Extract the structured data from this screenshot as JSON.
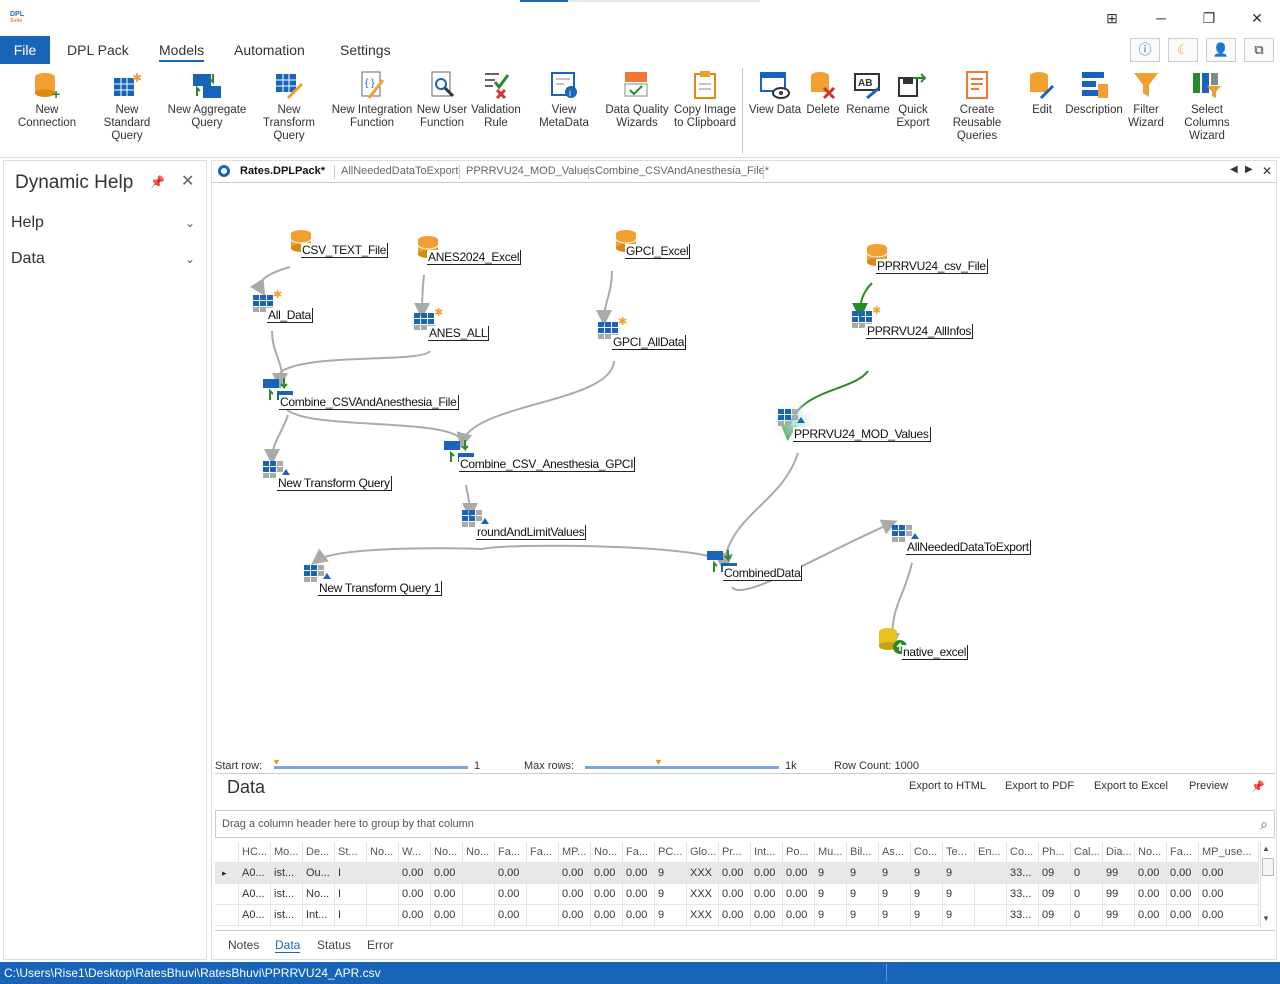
{
  "app": {
    "logo_top": "DPL",
    "logo_bottom": "Suite"
  },
  "menu": {
    "file": "File",
    "items": [
      "DPL Pack",
      "Models",
      "Automation",
      "Settings"
    ]
  },
  "top_icons": [
    "info-icon",
    "moon-icon",
    "user-icon",
    "layout-icon"
  ],
  "ribbon": {
    "buttons": [
      {
        "l1": "New Connection",
        "l2": ""
      },
      {
        "l1": "New Standard",
        "l2": "Query"
      },
      {
        "l1": "New Aggregate",
        "l2": "Query"
      },
      {
        "l1": "New Transform",
        "l2": "Query"
      },
      {
        "l1": "New Integration",
        "l2": "Function"
      },
      {
        "l1": "New User",
        "l2": "Function"
      },
      {
        "l1": "Validation",
        "l2": "Rule"
      },
      {
        "l1": "View MetaData",
        "l2": ""
      },
      {
        "l1": "Data Quality",
        "l2": "Wizards"
      },
      {
        "l1": "Copy Image",
        "l2": "to Clipboard"
      },
      {
        "l1": "View Data",
        "l2": ""
      },
      {
        "l1": "Delete",
        "l2": ""
      },
      {
        "l1": "Rename",
        "l2": ""
      },
      {
        "l1": "Quick",
        "l2": "Export"
      },
      {
        "l1": "Create Reusable",
        "l2": "Queries"
      },
      {
        "l1": "Edit",
        "l2": ""
      },
      {
        "l1": "Description",
        "l2": ""
      },
      {
        "l1": "Filter",
        "l2": "Wizard"
      },
      {
        "l1": "Select Columns",
        "l2": "Wizard"
      }
    ]
  },
  "left_panel": {
    "title": "Dynamic Help",
    "sections": [
      "Help",
      "Data"
    ]
  },
  "doc_tabs": [
    "Rates.DPLPack*",
    "AllNeededDataToExport",
    "PPRRVU24_MOD_Values",
    "Combine_CSVAndAnesthesia_File*"
  ],
  "nodes": {
    "csv_text": "CSV_TEXT_File",
    "anes_excel": "ANES2024_Excel",
    "gpci_excel": "GPCI_Excel",
    "pprrvu_csv": "PPRRVU24_csv_File",
    "all_data": "All_Data",
    "anes_all": "ANES_ALL",
    "gpci_alldata": "GPCI_AllData",
    "pprrvu_allinfos": "PPRRVU24_AllInfos",
    "combine_csv": "Combine_CSVAndAnesthesia_File",
    "pprrvu_mod": "PPRRVU24_MOD_Values",
    "new_transform": "New Transform Query",
    "combine_gpci": "Combine_CSV_Anesthesia_GPCI",
    "round_limit": "roundAndLimitValues",
    "all_needed": "AllNeededDataToExport",
    "new_transform1": "New Transform Query 1",
    "combined": "CombinedData",
    "native_excel": "native_excel"
  },
  "sliders": {
    "start_label": "Start row:",
    "start_value": "1",
    "max_label": "Max rows:",
    "max_value": "1k",
    "row_count": "Row Count: 1000"
  },
  "data_panel": {
    "title": "Data",
    "actions": [
      "Export to HTML",
      "Export to PDF",
      "Export to Excel",
      "Preview"
    ],
    "group_hint": "Drag a column header here to group by that column",
    "columns": [
      "HC...",
      "Mo...",
      "De...",
      "St...",
      "No...",
      "W...",
      "No...",
      "No...",
      "Fa...",
      "Fa...",
      "MP...",
      "No...",
      "Fa...",
      "PC...",
      "Glo...",
      "Pr...",
      "Int...",
      "Po...",
      "Mu...",
      "Bil...",
      "As...",
      "Co...",
      "Te...",
      "En...",
      "Co...",
      "Ph...",
      "Cal...",
      "Dia...",
      "No...",
      "Fa...",
      "MP_use..."
    ],
    "rows": [
      [
        "A0...",
        "ist...",
        "Ou...",
        "I",
        "",
        "0.00",
        "0.00",
        "",
        "0.00",
        "",
        "0.00",
        "0.00",
        "0.00",
        "9",
        "XXX",
        "0.00",
        "0.00",
        "0.00",
        "9",
        "9",
        "9",
        "9",
        "9",
        "",
        "33...",
        "09",
        "0",
        "99",
        "0.00",
        "0.00",
        "0.00"
      ],
      [
        "A0...",
        "ist...",
        "No...",
        "I",
        "",
        "0.00",
        "0.00",
        "",
        "0.00",
        "",
        "0.00",
        "0.00",
        "0.00",
        "9",
        "XXX",
        "0.00",
        "0.00",
        "0.00",
        "9",
        "9",
        "9",
        "9",
        "9",
        "",
        "33...",
        "09",
        "0",
        "99",
        "0.00",
        "0.00",
        "0.00"
      ],
      [
        "A0...",
        "ist...",
        "Int...",
        "I",
        "",
        "0.00",
        "0.00",
        "",
        "0.00",
        "",
        "0.00",
        "0.00",
        "0.00",
        "9",
        "XXX",
        "0.00",
        "0.00",
        "0.00",
        "9",
        "9",
        "9",
        "9",
        "9",
        "",
        "33...",
        "09",
        "0",
        "99",
        "0.00",
        "0.00",
        "0.00"
      ]
    ],
    "bottom_tabs": [
      "Notes",
      "Data",
      "Status",
      "Error"
    ]
  },
  "status": {
    "path": "C:\\Users\\Rise1\\Desktop\\RatesBhuvi\\RatesBhuvi\\PPRRVU24_APR.csv"
  },
  "colors": {
    "accent": "#1764b8",
    "orange": "#f0a030",
    "green": "#2a8a2a",
    "edge": "#aaaaaa"
  }
}
